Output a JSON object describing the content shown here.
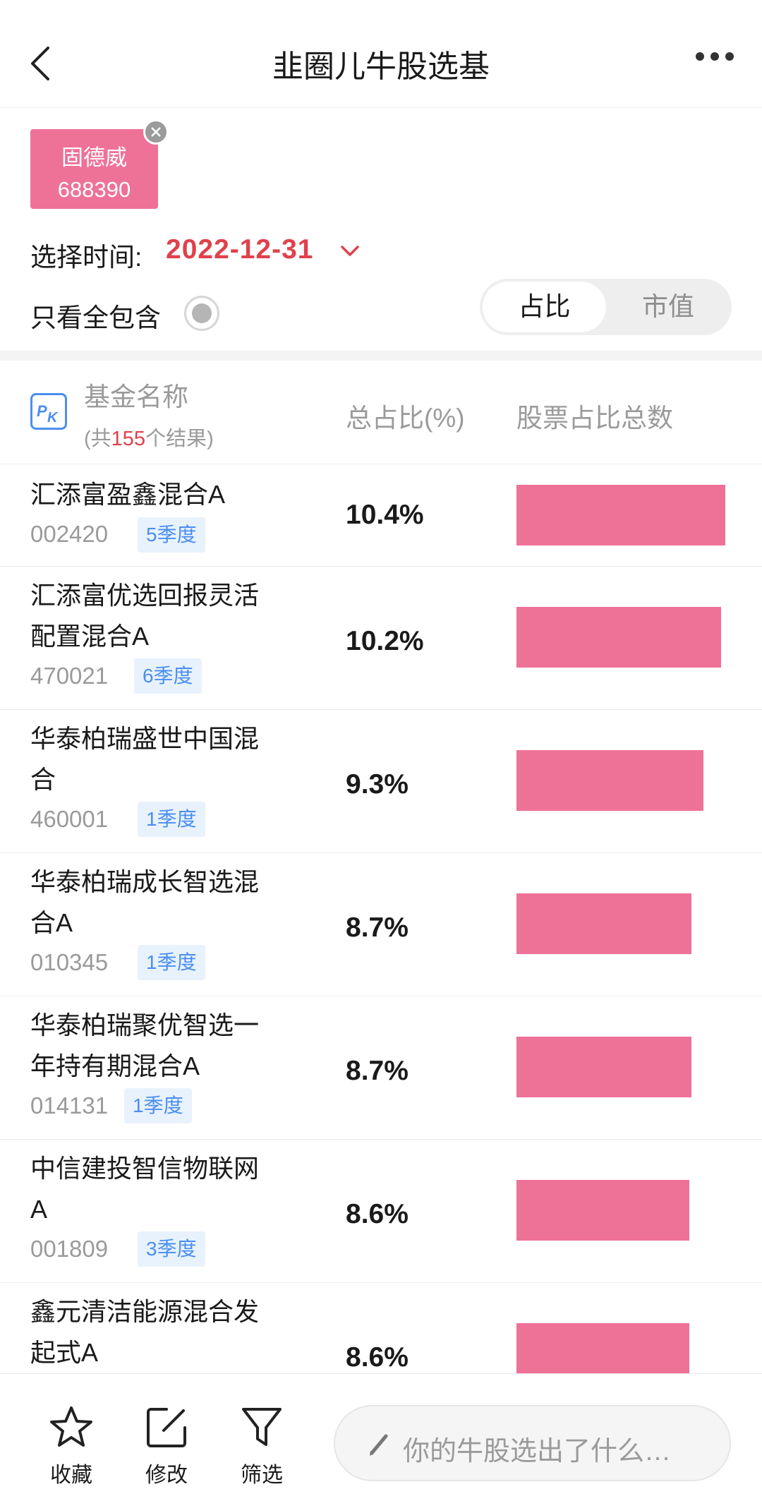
{
  "nav": {
    "title": "韭圈儿牛股选基",
    "back_icon": "chevron-left-icon",
    "more_icon": "more-dots-icon"
  },
  "stock_chip": {
    "name": "固德威",
    "code": "688390",
    "close_icon": "close-icon"
  },
  "date_selector": {
    "label": "选择时间:",
    "value": "2022-12-31"
  },
  "only_all": {
    "label": "只看全包含",
    "checked": false
  },
  "segment": {
    "active": "占比",
    "inactive": "市值"
  },
  "table_header": {
    "name": "基金名称",
    "count_prefix": "(共",
    "count": "155",
    "count_suffix": "个结果)",
    "ratio": "总占比(%)",
    "total": "股票占比总数"
  },
  "rows": [
    {
      "name": "汇添富盈鑫混合A",
      "code": "002420",
      "badge": "5季度",
      "pct": "10.4%",
      "value": 10.4
    },
    {
      "name": "汇添富优选回报灵活配置混合A",
      "code": "470021",
      "badge": "6季度",
      "pct": "10.2%",
      "value": 10.2
    },
    {
      "name": "华泰柏瑞盛世中国混合",
      "code": "460001",
      "badge": "1季度",
      "pct": "9.3%",
      "value": 9.3
    },
    {
      "name": "华泰柏瑞成长智选混合A",
      "code": "010345",
      "badge": "1季度",
      "pct": "8.7%",
      "value": 8.7
    },
    {
      "name": "华泰柏瑞聚优智选一年持有期混合A",
      "code": "014131",
      "badge": "1季度",
      "pct": "8.7%",
      "value": 8.7
    },
    {
      "name": "中信建投智信物联网A",
      "code": "001809",
      "badge": "3季度",
      "pct": "8.6%",
      "value": 8.6
    },
    {
      "name": "鑫元清洁能源混合发起式A",
      "code": "",
      "badge": "",
      "pct": "8.6%",
      "value": 8.6
    }
  ],
  "toolbar": {
    "collect": "收藏",
    "edit": "修改",
    "filter": "筛选",
    "compose_placeholder": "你的牛股选出了什么…"
  },
  "colors": {
    "accent_pink": "#ee7198",
    "accent_red": "#e0414c",
    "badge_blue": "#4a8ef0"
  }
}
